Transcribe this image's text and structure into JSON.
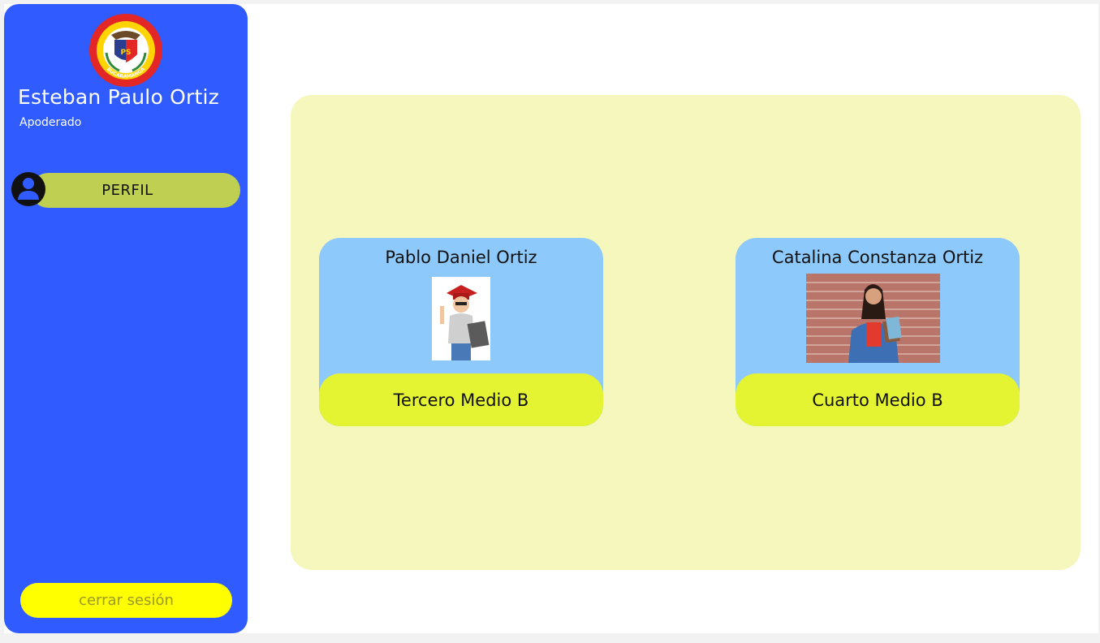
{
  "school": {
    "logo_top_text": "COLEGIO SAN PEDRO CLAVER",
    "logo_bottom_text": "BUCARAMANGA",
    "logo_monogram": "PS"
  },
  "user": {
    "name": "Esteban Paulo Ortiz",
    "role": "Apoderado"
  },
  "nav": {
    "profile_label": "PERFIL",
    "profile_icon": "user-circle-icon",
    "logout_label": "cerrar sesión"
  },
  "students": [
    {
      "name": "Pablo Daniel Ortiz",
      "grade": "Tercero Medio B"
    },
    {
      "name": "Catalina Constanza Ortiz",
      "grade": "Cuarto Medio B"
    }
  ],
  "colors": {
    "sidebar": "#2f5bff",
    "profile_button": "#bfcf52",
    "logout_button": "#ffff00",
    "panel": "#f5f7bc",
    "card": "#8ec9fb",
    "card_footer": "#e5f432"
  }
}
